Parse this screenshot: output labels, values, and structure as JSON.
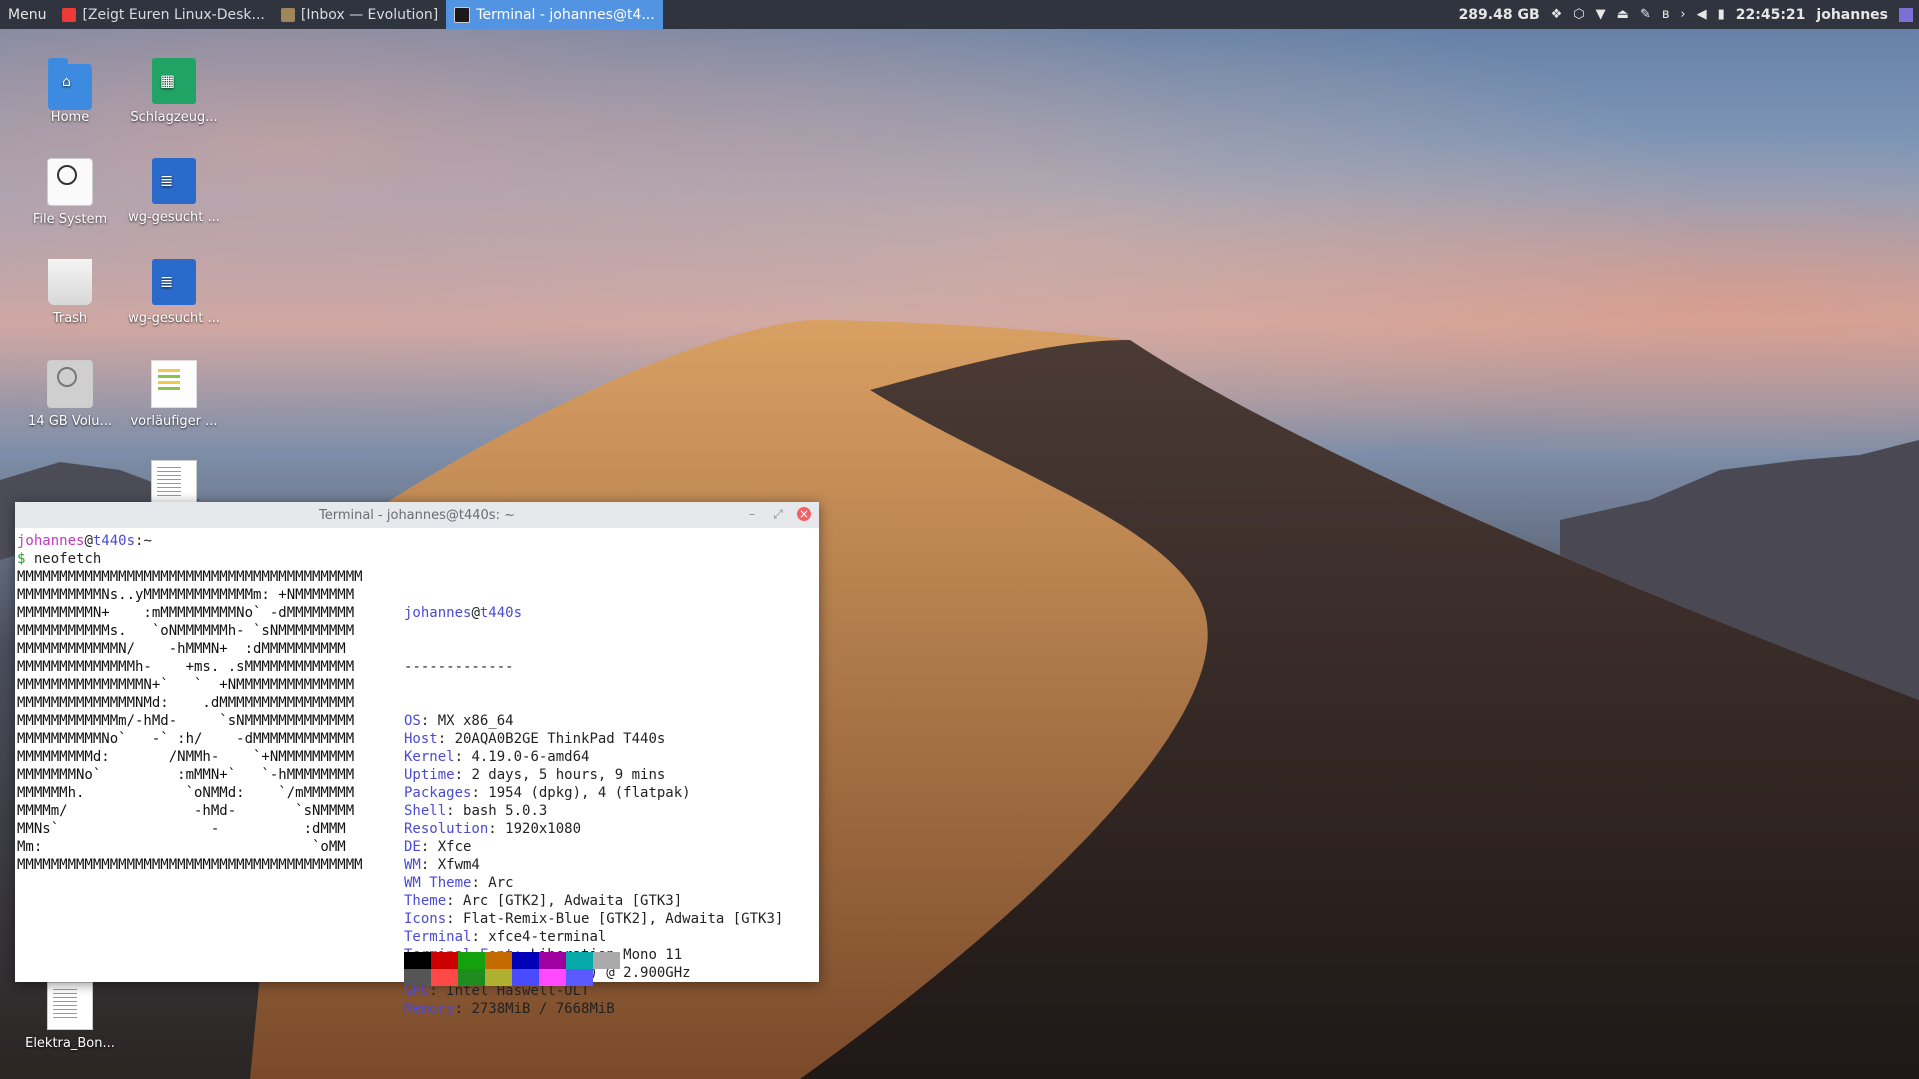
{
  "panel": {
    "menu_label": "Menu",
    "tasks": [
      {
        "label": "[Zeigt Euren Linux-Desk...",
        "icon": "vivaldi-icon",
        "color": "#ef3939"
      },
      {
        "label": "[Inbox — Evolution]",
        "icon": "evolution-icon",
        "color": "#a0875a"
      },
      {
        "label": "Terminal - johannes@t4...",
        "icon": "terminal-icon",
        "color": "#1a1a1a"
      }
    ],
    "disk_free": "289.48 GB",
    "clock": "22:45:21",
    "user": "johannes"
  },
  "desktop": {
    "icons": [
      {
        "label": "Home",
        "icon": "home-folder-icon"
      },
      {
        "label": "Schlagzeug...",
        "icon": "spreadsheet-icon"
      },
      {
        "label": "File System",
        "icon": "drive-icon"
      },
      {
        "label": "wg-gesucht ...",
        "icon": "document-icon"
      },
      {
        "label": "Trash",
        "icon": "trash-icon"
      },
      {
        "label": "wg-gesucht ...",
        "icon": "document-icon"
      },
      {
        "label": "14 GB Volu...",
        "icon": "volume-icon"
      },
      {
        "label": "vorläufiger ...",
        "icon": "image-document-icon"
      },
      {
        "label": "Elektra_Bon...",
        "icon": "text-file-icon"
      }
    ]
  },
  "terminal": {
    "title": "Terminal - johannes@t440s: ~",
    "prompt_user": "johannes",
    "prompt_at": "@",
    "prompt_host": "t440s",
    "prompt_path": ":~",
    "prompt_symbol": "$",
    "command": "neofetch",
    "logo": "MMMMMMMMMMMMMMMMMMMMMMMMMMMMMMMMMMMMMMMMM\nMMMMMMMMMMNs..yMMMMMMMMMMMMMm: +NMMMMMMM\nMMMMMMMMMN+    :mMMMMMMMMMNo` -dMMMMMMMM\nMMMMMMMMMMMs.   `oNMMMMMMh- `sNMMMMMMMMM\nMMMMMMMMMMMMN/    -hMMMN+  :dMMMMMMMMMM\nMMMMMMMMMMMMMMh-    +ms. .sMMMMMMMMMMMMM\nMMMMMMMMMMMMMMMN+`   `  +NMMMMMMMMMMMMMM\nMMMMMMMMMMMMMMNMd:    .dMMMMMMMMMMMMMMMM\nMMMMMMMMMMMMm/-hMd-     `sNMMMMMMMMMMMMM\nMMMMMMMMMMNo`   -` :h/    -dMMMMMMMMMMMM\nMMMMMMMMMd:       /NMMh-    `+NMMMMMMMMM\nMMMMMMMNo`         :mMMN+`   `-hMMMMMMMM\nMMMMMMh.            `oNMMd:    `/mMMMMMM\nMMMMm/               -hMd-       `sNMMMM\nMMNs`                  -          :dMMM\nMm:                                `oMM\nMMMMMMMMMMMMMMMMMMMMMMMMMMMMMMMMMMMMMMMMM",
    "info_header_user": "johannes",
    "info_header_host": "t440s",
    "info_separator": "-------------",
    "info": [
      {
        "key": "OS",
        "value": "MX x86_64"
      },
      {
        "key": "Host",
        "value": "20AQA0B2GE ThinkPad T440s"
      },
      {
        "key": "Kernel",
        "value": "4.19.0-6-amd64"
      },
      {
        "key": "Uptime",
        "value": "2 days, 5 hours, 9 mins"
      },
      {
        "key": "Packages",
        "value": "1954 (dpkg), 4 (flatpak)"
      },
      {
        "key": "Shell",
        "value": "bash 5.0.3"
      },
      {
        "key": "Resolution",
        "value": "1920x1080"
      },
      {
        "key": "DE",
        "value": "Xfce"
      },
      {
        "key": "WM",
        "value": "Xfwm4"
      },
      {
        "key": "WM Theme",
        "value": "Arc"
      },
      {
        "key": "Theme",
        "value": "Arc [GTK2], Adwaita [GTK3]"
      },
      {
        "key": "Icons",
        "value": "Flat-Remix-Blue [GTK2], Adwaita [GTK3]"
      },
      {
        "key": "Terminal",
        "value": "xfce4-terminal"
      },
      {
        "key": "Terminal Font",
        "value": "Liberation Mono 11"
      },
      {
        "key": "CPU",
        "value": "Intel i5-4300U (4) @ 2.900GHz"
      },
      {
        "key": "GPU",
        "value": "Intel Haswell-ULT"
      },
      {
        "key": "Memory",
        "value": "2738MiB / 7668MiB"
      }
    ],
    "palette_row1": [
      "#000000",
      "#cc0000",
      "#13a10e",
      "#c36a00",
      "#0000b8",
      "#a100a1",
      "#06aaa9",
      "#aaaaaa"
    ],
    "palette_row2": [
      "#555555",
      "#ff4848",
      "#1f8c1f",
      "#b0b030",
      "#4a4aff",
      "#ff4aff",
      "#5a5aff"
    ]
  }
}
